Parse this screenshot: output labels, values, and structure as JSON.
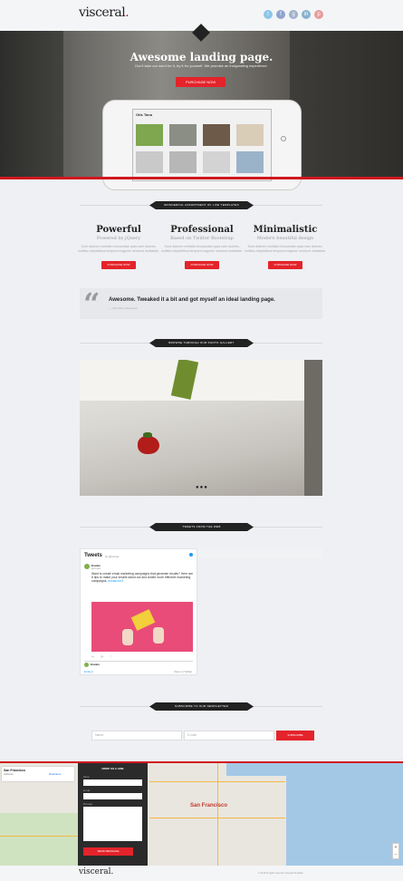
{
  "header": {
    "logo_text": "visceral",
    "logo_dot": ".",
    "social_icons": [
      {
        "name": "twitter-icon",
        "glyph": "t",
        "color": "#8cc6e8"
      },
      {
        "name": "facebook-icon",
        "glyph": "f",
        "color": "#8fa4d0"
      },
      {
        "name": "google-plus-icon",
        "glyph": "g",
        "color": "#9fb0c9"
      },
      {
        "name": "linkedin-icon",
        "glyph": "in",
        "color": "#88b2cf"
      },
      {
        "name": "pinterest-icon",
        "glyph": "p",
        "color": "#e79b9b"
      }
    ]
  },
  "hero": {
    "title": "Awesome landing page.",
    "subtitle": "Don't take our word for it, try it for yourself. We promise an invigorating experience.",
    "button": "PURCHASE NOW",
    "screen_app_title": "Otis Tana"
  },
  "features": {
    "banner": "WONDERFUL ASSORTMENT OF LIVE TEMPLATES",
    "items": [
      {
        "title": "Powerful",
        "subtitle": "Powered by jQuery",
        "text": "Sunt dolorem veritatis recusandae quas nam dolores, mollitia voluptatibus tempora magnam nesciunt molestiae.",
        "button": "PURCHASE NOW"
      },
      {
        "title": "Professional",
        "subtitle": "Based on Twitter Bootstrap",
        "text": "Sunt dolorem veritatis recusandae quas nam dolores, mollitia voluptatibus tempora magnam nesciunt molestiae.",
        "button": "PURCHASE NOW"
      },
      {
        "title": "Minimalistic",
        "subtitle": "Modern beautiful design",
        "text": "Sunt dolorem veritatis recusandae quas nam dolores, mollitia voluptatibus tempora magnam nesciunt molestiae.",
        "button": "PURCHASE NOW"
      }
    ]
  },
  "testimonial": {
    "quote": "Awesome. Tweaked it a bit and got myself an ideal landing page.",
    "cite": "— John Doe, Developer"
  },
  "gallery": {
    "banner": "BROWSE THROUGH OUR PHOTO GALLERY",
    "dots": "●●●"
  },
  "tweets": {
    "banner": "TWEETS FROM THE WEB",
    "title": "Tweets",
    "by": "by @ozone",
    "user": "Envato",
    "handle": "@envato",
    "text": "Want to create email marketing campaigns that generate results? Here are 8 tips to make your emails stand out and create more effective marketing campaigns.",
    "link": "envato.to/3",
    "embed": "Embed",
    "view_on": "View on Twitter"
  },
  "newsletter": {
    "banner": "SUBSCRIBE TO OUR NEWSLETTER",
    "name_placeholder": "Name",
    "email_placeholder": "E-mail",
    "button": "SUBSCRIBE"
  },
  "map": {
    "place_name": "San Francisco",
    "place_sub": "California",
    "directions": "Directions",
    "city_label": "San Francisco",
    "zoom_in": "+",
    "zoom_out": "−"
  },
  "contact": {
    "title": "DROP US A LINE",
    "name_label": "Name",
    "email_label": "E-mail",
    "message_label": "Message",
    "button": "SEND MESSAGE"
  },
  "footer": {
    "logo": "visceral.",
    "copyright": "© 2014 All rights reserved. Visceral Template"
  }
}
